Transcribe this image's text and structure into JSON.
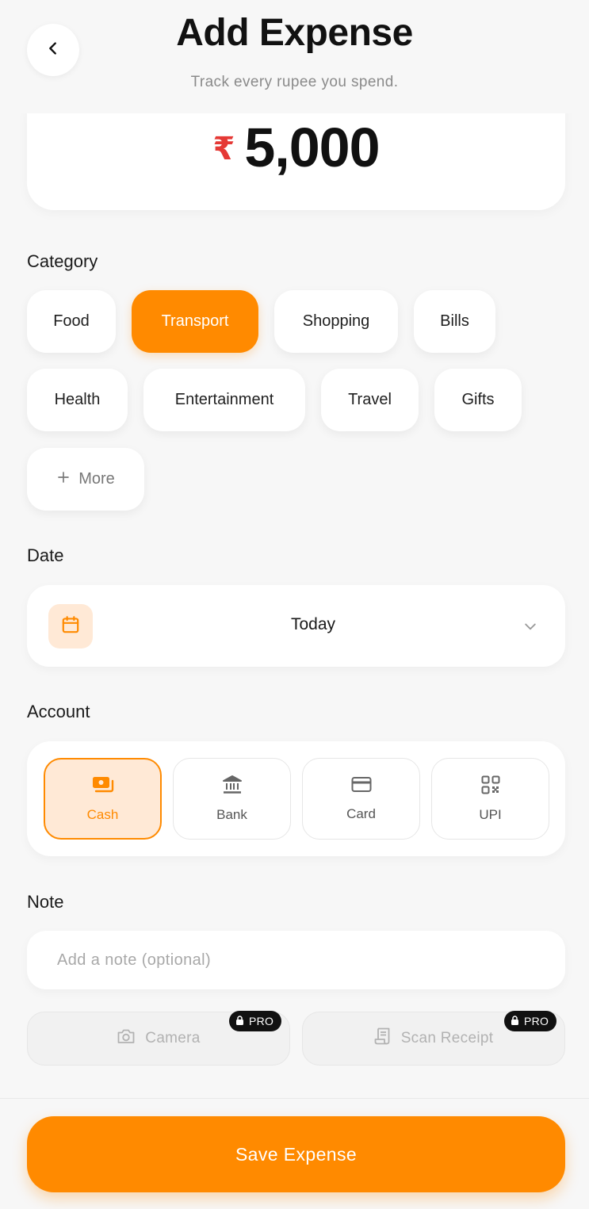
{
  "header": {
    "title": "Add Expense",
    "subtitle": "Track every rupee you spend."
  },
  "amount": {
    "currency_symbol": "₹",
    "value": "5,000"
  },
  "category": {
    "label": "Category",
    "chips": [
      "Food",
      "Transport",
      "Shopping",
      "Bills",
      "Health",
      "Entertainment",
      "Travel",
      "Gifts"
    ],
    "selected": "Transport",
    "more_label": "More"
  },
  "date": {
    "label": "Date",
    "value": "Today"
  },
  "account": {
    "label": "Account",
    "options": [
      "Cash",
      "Bank",
      "Card",
      "UPI"
    ],
    "selected": "Cash"
  },
  "note": {
    "label": "Note",
    "placeholder": "Add a note (optional)"
  },
  "attachments": {
    "camera_label": "Camera",
    "scan_label": "Scan Receipt",
    "badge": "PRO"
  },
  "footer": {
    "save_label": "Save Expense"
  },
  "colors": {
    "accent": "#ff8a00",
    "accent_soft": "#ffe9d6",
    "currency": "#e53935"
  }
}
